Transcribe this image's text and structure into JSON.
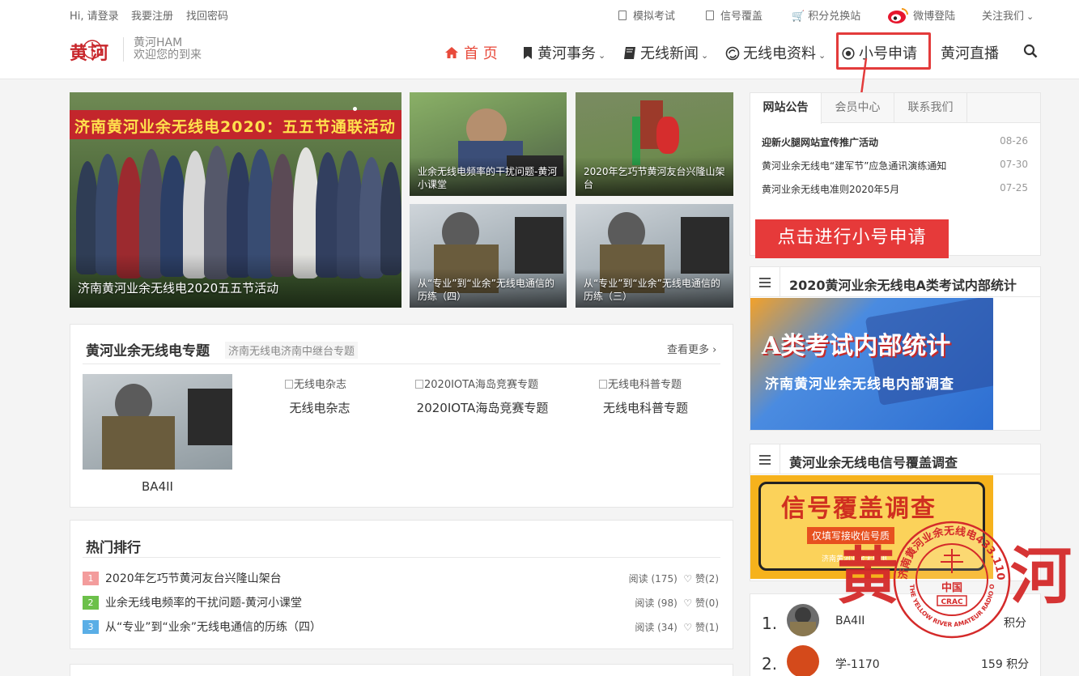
{
  "topbar": {
    "login": "Hi, 请登录",
    "register": "我要注册",
    "retrieve": "找回密码",
    "mock_exam": "模拟考试",
    "signal_cover": "信号覆盖",
    "points_shop": "积分兑换站",
    "weibo_login": "微博登陆",
    "follow_us": "关注我们"
  },
  "brand": {
    "logo_text": "黄河",
    "site_name": "黄河HAM",
    "slogan": "欢迎您的到来"
  },
  "nav": [
    {
      "label": "首 页",
      "icon": "home-icon"
    },
    {
      "label": "黄河事务",
      "icon": "bookmark-icon"
    },
    {
      "label": "无线新闻",
      "icon": "book-icon"
    },
    {
      "label": "无线电资料",
      "icon": "refresh-icon"
    },
    {
      "label": "小号申请",
      "icon": "target-icon"
    },
    {
      "label": "黄河直播",
      "icon": ""
    }
  ],
  "slider": {
    "banner_text": "济南黄河业余无线电2020：五五节通联活动",
    "main_caption": "济南黄河业余无线电2020五五节活动",
    "thumbs": [
      {
        "caption": "业余无线电频率的干扰问题-黄河小课堂"
      },
      {
        "caption": "2020年乞巧节黄河友台兴隆山架台"
      },
      {
        "caption": "从“专业”到“业余”无线电通信的历练（四）"
      },
      {
        "caption": "从“专业”到“业余”无线电通信的历练（三）"
      }
    ]
  },
  "topic": {
    "title": "黄河业余无线电专题",
    "subtitle": "济南无线电济南中继台专题",
    "more": "查看更多",
    "items": [
      {
        "label": "BA4II",
        "alt": ""
      },
      {
        "label": "无线电杂志",
        "alt": "无线电杂志"
      },
      {
        "label": "2020IOTA海岛竞赛专题",
        "alt": "2020IOTA海岛竞赛专题"
      },
      {
        "label": "无线电科普专题",
        "alt": "无线电科普专题"
      }
    ]
  },
  "hot": {
    "title": "热门排行",
    "rows": [
      {
        "rank": "1",
        "title": "2020年乞巧节黄河友台兴隆山架台",
        "reads": "阅读 (175)",
        "likes": "赞(2)",
        "color": "#f39c9c"
      },
      {
        "rank": "2",
        "title": "业余无线电频率的干扰问题-黄河小课堂",
        "reads": "阅读 (98)",
        "likes": "赞(0)",
        "color": "#6cc04a"
      },
      {
        "rank": "3",
        "title": "从“专业”到“业余”无线电通信的历练（四）",
        "reads": "阅读 (34)",
        "likes": "赞(1)",
        "color": "#5aaee6"
      }
    ]
  },
  "notice": {
    "tabs": [
      "网站公告",
      "会员中心",
      "联系我们"
    ],
    "rows": [
      {
        "title": "迎新火腿网站宣传推广活动",
        "date": "08-26"
      },
      {
        "title": "黄河业余无线电“建军节”应急通讯演练通知",
        "date": "07-30"
      },
      {
        "title": "黄河业余无线电准则2020年5月",
        "date": "07-25"
      }
    ],
    "callout": "点击进行小号申请"
  },
  "widget1": {
    "title": "2020黄河业余无线电A类考试内部统计",
    "banner_main": "A类考试内部统计",
    "banner_sub": "济南黄河业余无线电内部调查"
  },
  "widget2": {
    "title": "黄河业余无线电信号覆盖调查",
    "banner_main": "信号覆盖调查",
    "banner_sub": "仅填写接收信号质",
    "banner_foot": "济南黄河业余无线电"
  },
  "ranking": {
    "rows": [
      {
        "rank": "1.",
        "name": "BA4II",
        "points": "积分"
      },
      {
        "rank": "2.",
        "name": "学-1170",
        "points": "159 积分"
      }
    ]
  },
  "watermark": {
    "left": "黄",
    "right": "河",
    "ring_text": "济南黄河业余无线电433.110MHz",
    "ring_en": "THE YELLOW RIVER AMATEUR RADIO OF JINAN",
    "center": "中国",
    "badge": "CRAC"
  },
  "colors": {
    "accent": "#e84a3b",
    "callout_bg": "#e63a3a",
    "highlight_box": "#e33b3b"
  }
}
